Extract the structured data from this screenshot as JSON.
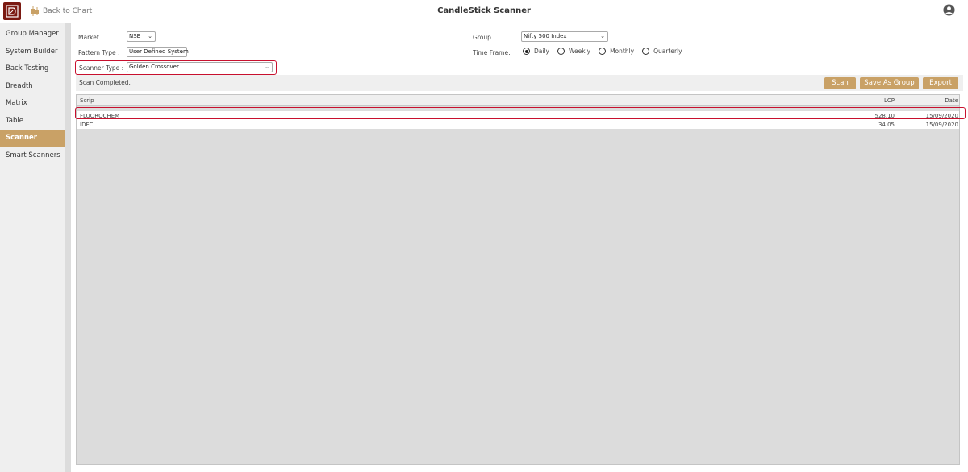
{
  "app": {
    "title": "CandleStick Scanner",
    "back_label": "Back to Chart"
  },
  "sidebar": {
    "items": [
      {
        "label": "Group Manager"
      },
      {
        "label": "System Builder"
      },
      {
        "label": "Back Testing"
      },
      {
        "label": "Breadth"
      },
      {
        "label": "Matrix"
      },
      {
        "label": "Table"
      },
      {
        "label": "Scanner",
        "active": true
      },
      {
        "label": "Smart Scanners"
      }
    ]
  },
  "form": {
    "market_label": "Market :",
    "market_value": "NSE",
    "pattern_label": "Pattern Type :",
    "pattern_value": "User Defined System",
    "scanner_label": "Scanner Type :",
    "scanner_value": "Golden Crossover",
    "group_label": "Group :",
    "group_value": "Nifty 500 Index",
    "timeframe_label": "Time Frame:",
    "timeframe_options": [
      {
        "label": "Daily",
        "selected": true
      },
      {
        "label": "Weekly",
        "selected": false
      },
      {
        "label": "Monthly",
        "selected": false
      },
      {
        "label": "Quarterly",
        "selected": false
      }
    ]
  },
  "status": {
    "text": "Scan Completed."
  },
  "actions": {
    "scan": "Scan",
    "save_group": "Save As Group",
    "export": "Export"
  },
  "table": {
    "columns": [
      "Scrip",
      "LCP",
      "Date"
    ],
    "rows": [
      {
        "scrip": "FLUOROCHEM",
        "lcp": "528.10",
        "date": "15/09/2020"
      },
      {
        "scrip": "IDFC",
        "lcp": "34.05",
        "date": "15/09/2020"
      }
    ]
  },
  "colors": {
    "accent": "#c9a166",
    "highlight": "#c8102e",
    "logo": "#7b1a12"
  }
}
